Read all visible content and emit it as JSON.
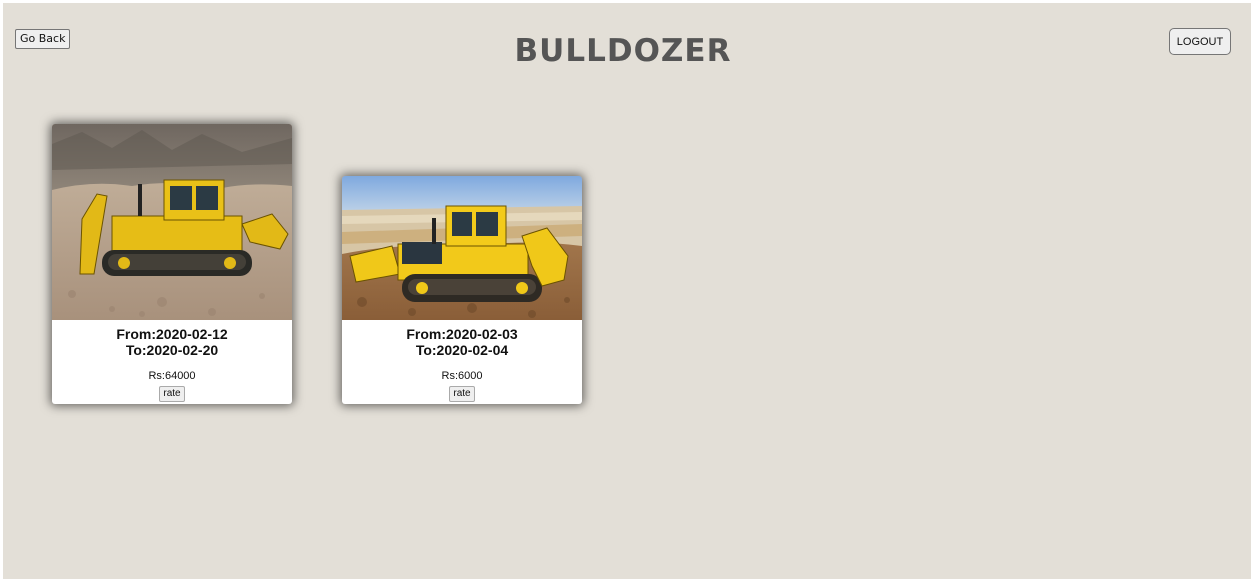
{
  "header": {
    "back_label": "Go Back",
    "title": "BULLDOZER",
    "logout_label": "LOGOUT"
  },
  "bookings": [
    {
      "from": "From:2020-02-12",
      "to": "To:2020-02-20",
      "price": "Rs:64000",
      "rate_label": "rate"
    },
    {
      "from": "From:2020-02-03",
      "to": "To:2020-02-04",
      "price": "Rs:6000",
      "rate_label": "rate"
    }
  ],
  "colors": {
    "background": "#e3dfd7",
    "title": "#555555",
    "card": "#ffffff"
  }
}
